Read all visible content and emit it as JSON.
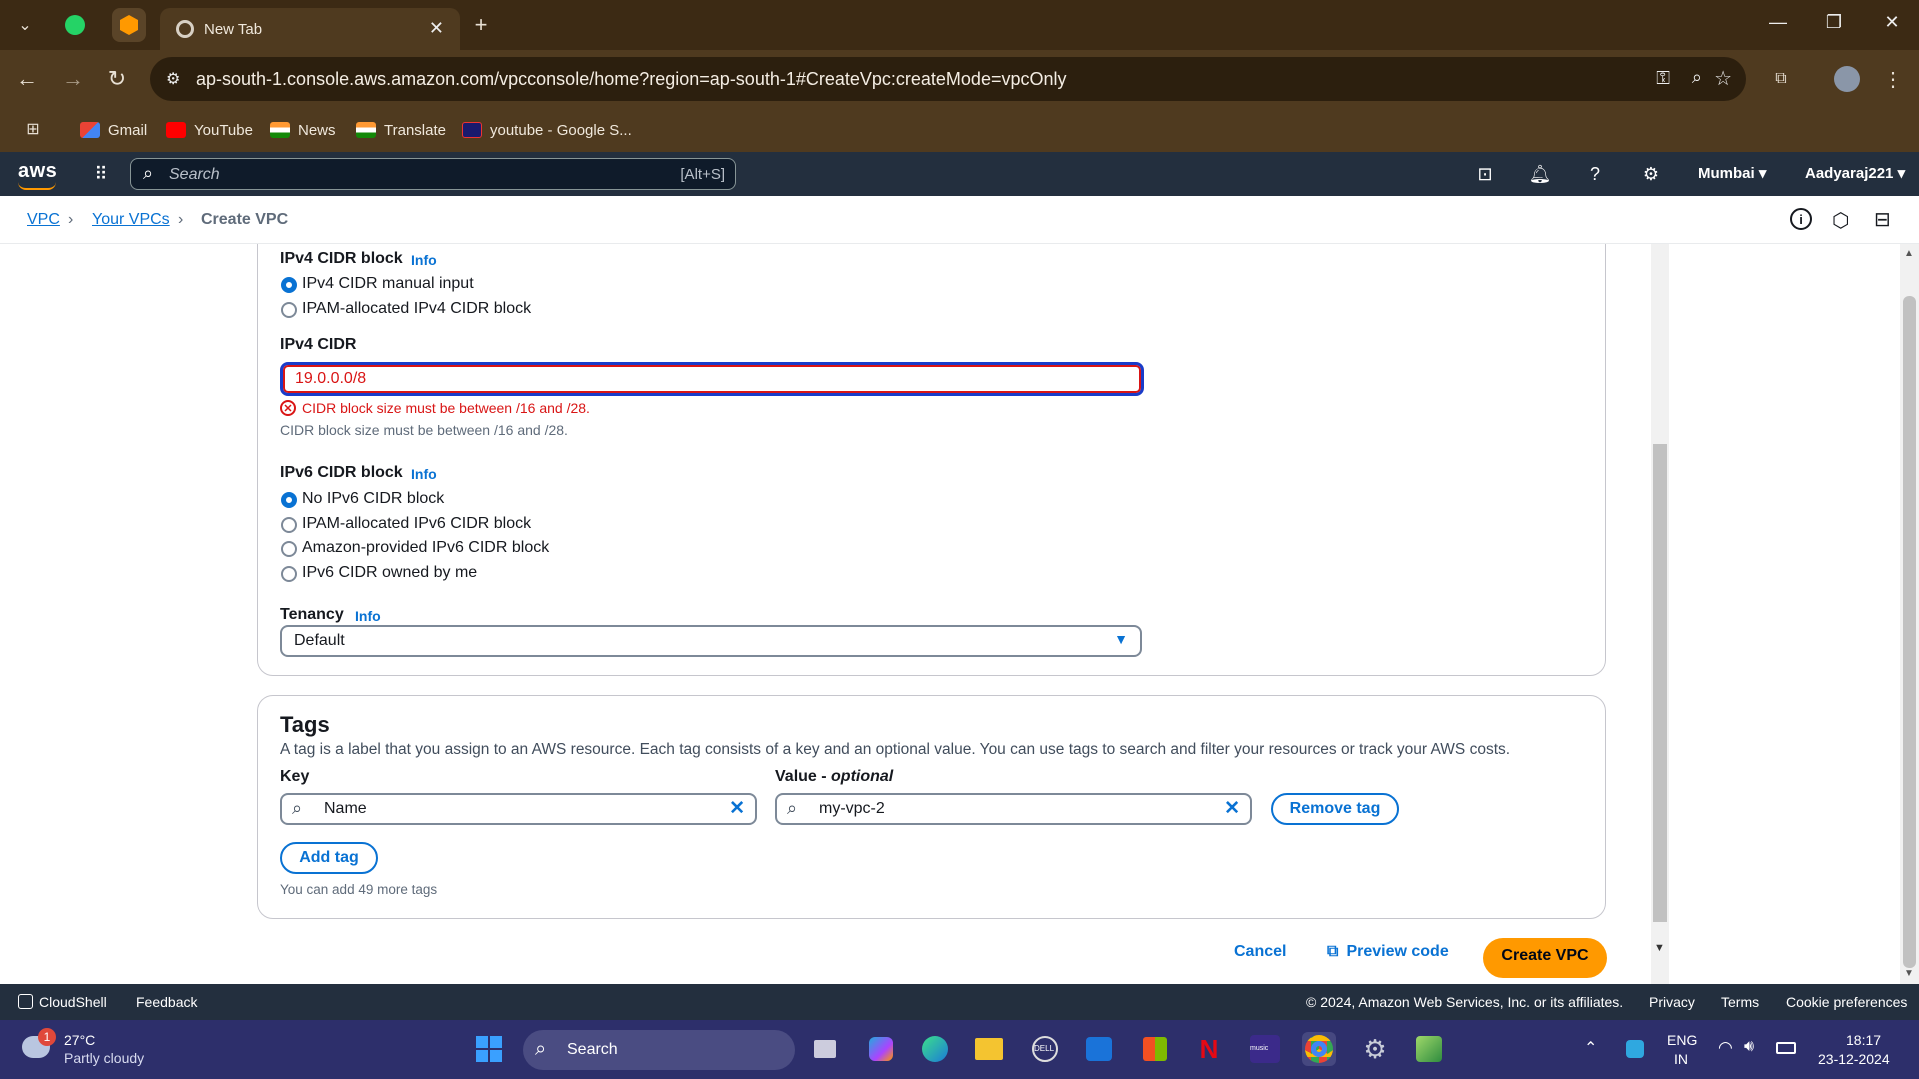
{
  "browser": {
    "tab_title": "New Tab",
    "url": "ap-south-1.console.aws.amazon.com/vpcconsole/home?region=ap-south-1#CreateVpc:createMode=vpcOnly",
    "bookmarks": [
      {
        "label": "Gmail",
        "icon": "gmail-icon"
      },
      {
        "label": "YouTube",
        "icon": "youtube-icon"
      },
      {
        "label": "News",
        "icon": "india-flag-icon"
      },
      {
        "label": "Translate",
        "icon": "india-flag-icon"
      },
      {
        "label": "youtube - Google S...",
        "icon": "su-icon"
      }
    ]
  },
  "aws": {
    "logo": "aws",
    "search_placeholder": "Search",
    "search_shortcut": "[Alt+S]",
    "region": "Mumbai ▾",
    "account": "Aadyaraj221 ▾"
  },
  "breadcrumb": {
    "items": [
      "VPC",
      "Your VPCs"
    ],
    "current": "Create VPC"
  },
  "form": {
    "ipv4_block": {
      "label": "IPv4 CIDR block",
      "info": "Info",
      "options": [
        "IPv4 CIDR manual input",
        "IPAM-allocated IPv4 CIDR block"
      ],
      "selected": "IPv4 CIDR manual input"
    },
    "ipv4_cidr": {
      "label": "IPv4 CIDR",
      "value": "19.0.0.0/8",
      "error": "CIDR block size must be between /16 and /28.",
      "hint": "CIDR block size must be between /16 and /28."
    },
    "ipv6_block": {
      "label": "IPv6 CIDR block",
      "info": "Info",
      "options": [
        "No IPv6 CIDR block",
        "IPAM-allocated IPv6 CIDR block",
        "Amazon-provided IPv6 CIDR block",
        "IPv6 CIDR owned by me"
      ],
      "selected": "No IPv6 CIDR block"
    },
    "tenancy": {
      "label": "Tenancy",
      "info": "Info",
      "value": "Default"
    }
  },
  "tags": {
    "title": "Tags",
    "description": "A tag is a label that you assign to an AWS resource. Each tag consists of a key and an optional value. You can use tags to search and filter your resources or track your AWS costs.",
    "key_label": "Key",
    "value_label": "Value - ",
    "value_label_optional": "optional",
    "key_value": "Name",
    "value_value": "my-vpc-2",
    "remove_label": "Remove tag",
    "add_label": "Add tag",
    "remaining": "You can add 49 more tags"
  },
  "actions": {
    "cancel": "Cancel",
    "preview": "Preview code",
    "create": "Create VPC"
  },
  "footer": {
    "cloudshell": "CloudShell",
    "feedback": "Feedback",
    "copyright": "© 2024, Amazon Web Services, Inc. or its affiliates.",
    "privacy": "Privacy",
    "terms": "Terms",
    "cookies": "Cookie preferences"
  },
  "taskbar": {
    "weather_temp": "27°C",
    "weather_desc": "Partly cloudy",
    "weather_badge": "1",
    "search": "Search",
    "lang_1": "ENG",
    "lang_2": "IN",
    "time": "18:17",
    "date": "23-12-2024"
  },
  "colors": {
    "aws_nav": "#232f3e",
    "link": "#0972d3",
    "error": "#d91515",
    "primary_button": "#ff9900",
    "browser_frame": "#4f3a1f"
  }
}
